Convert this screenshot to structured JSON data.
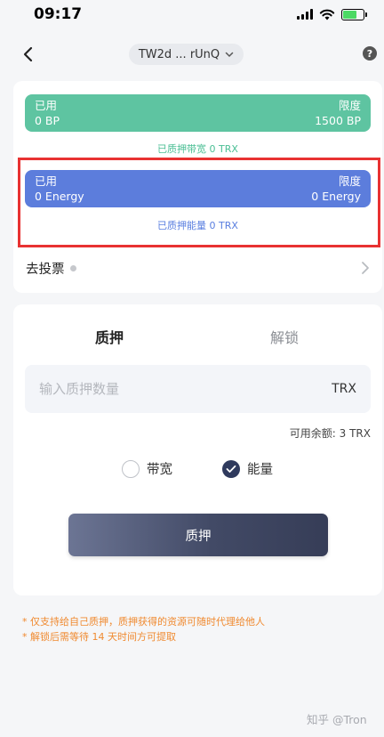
{
  "status_bar": {
    "time": "09:17"
  },
  "header": {
    "account": "TW2d ... rUnQ",
    "help": "?"
  },
  "resources": {
    "bandwidth": {
      "used_label": "已用",
      "limit_label": "限度",
      "used_value": "0 BP",
      "limit_value": "1500 BP",
      "frozen_text": "已质押带宽 0 TRX",
      "color": "#5ec4a1"
    },
    "energy": {
      "used_label": "已用",
      "limit_label": "限度",
      "used_value": "0 Energy",
      "limit_value": "0 Energy",
      "frozen_text": "已质押能量 0 TRX",
      "color": "#5c7ddc"
    },
    "vote_label": "去投票"
  },
  "stake_panel": {
    "tabs": [
      {
        "label": "质押",
        "active": true
      },
      {
        "label": "解锁",
        "active": false
      }
    ],
    "input": {
      "placeholder": "输入质押数量",
      "value": "",
      "unit": "TRX"
    },
    "balance_text": "可用余额: 3 TRX",
    "options": [
      {
        "label": "带宽",
        "checked": false
      },
      {
        "label": "能量",
        "checked": true
      }
    ],
    "submit_label": "质押"
  },
  "notes": [
    "* 仅支持给自己质押，质押获得的资源可随时代理给他人",
    "* 解锁后需等待 14 天时间方可提取"
  ],
  "watermark": "知乎 @Tron",
  "colors": {
    "accent_dark": "#2f3a5d",
    "note": "#f08a30",
    "highlight": "#e83232"
  }
}
